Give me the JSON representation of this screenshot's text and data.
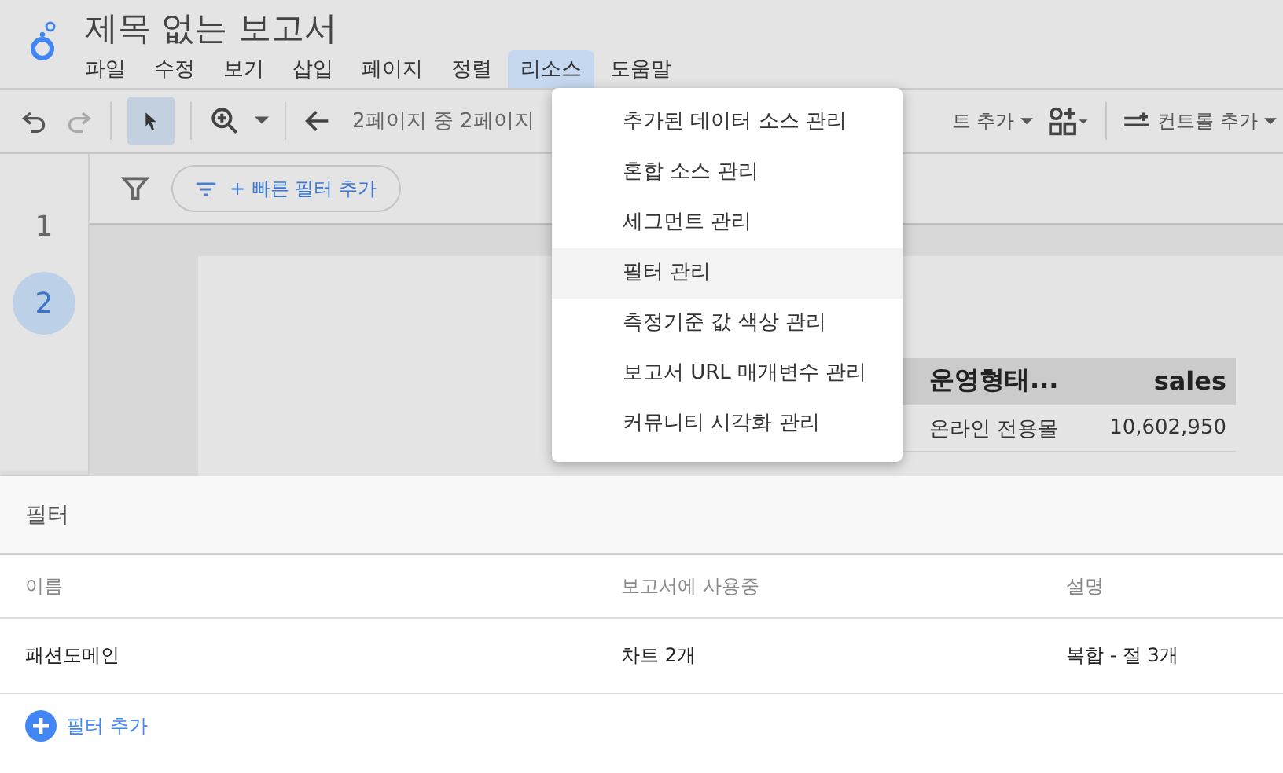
{
  "window": {
    "title": "제목 없는 보고서"
  },
  "menubar": [
    {
      "label": "파일",
      "selected": false
    },
    {
      "label": "수정",
      "selected": false
    },
    {
      "label": "보기",
      "selected": false
    },
    {
      "label": "삽입",
      "selected": false
    },
    {
      "label": "페이지",
      "selected": false
    },
    {
      "label": "정렬",
      "selected": false
    },
    {
      "label": "리소스",
      "selected": true
    },
    {
      "label": "도움말",
      "selected": false
    }
  ],
  "toolbar": {
    "page_nav": "2페이지 중 2페이지",
    "chart_add": "트 추가",
    "control_add": "컨트롤 추가"
  },
  "pages": [
    {
      "label": "1",
      "selected": false
    },
    {
      "label": "2",
      "selected": true
    }
  ],
  "quick_filter": "+ 빠른 필터 추가",
  "table": {
    "columns": [
      "운영형태...",
      "sales"
    ],
    "rows": [
      [
        "온라인 전용몰",
        "10,602,950"
      ]
    ]
  },
  "dropdown": [
    {
      "label": "추가된 데이터 소스 관리",
      "selected": false
    },
    {
      "label": "혼합 소스 관리",
      "selected": false
    },
    {
      "label": "세그먼트 관리",
      "selected": false
    },
    {
      "label": "필터 관리",
      "selected": true
    },
    {
      "label": "측정기준 값 색상 관리",
      "selected": false
    },
    {
      "label": "보고서 URL 매개변수 관리",
      "selected": false
    },
    {
      "label": "커뮤니티 시각화 관리",
      "selected": false
    }
  ],
  "filter_panel": {
    "title": "필터",
    "columns": [
      "이름",
      "보고서에 사용중",
      "설명"
    ],
    "rows": [
      [
        "패션도메인",
        "차트 2개",
        "복합 - 절 3개"
      ]
    ],
    "add_button": "필터 추가"
  }
}
